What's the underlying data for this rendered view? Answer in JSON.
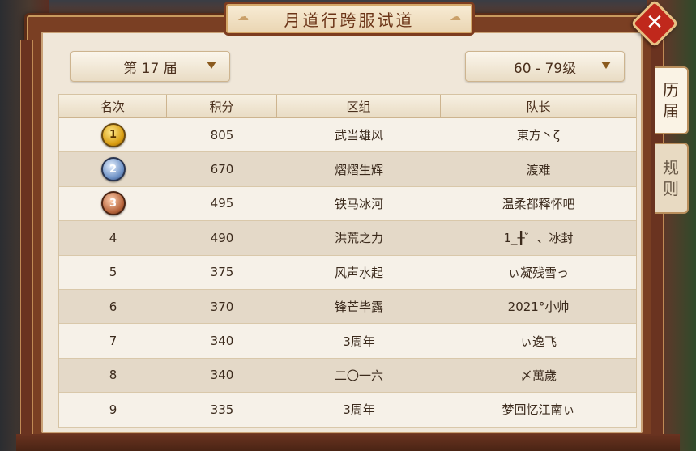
{
  "title": "月道行跨服试道",
  "close_label": "✕",
  "dropdowns": {
    "session": "第 17 届",
    "level": "60 - 79级"
  },
  "tabs": {
    "history": [
      "历",
      "届"
    ],
    "rules": [
      "规",
      "则"
    ]
  },
  "table": {
    "headers": [
      "名次",
      "积分",
      "区组",
      "队长"
    ],
    "rows": [
      {
        "rank": "1",
        "medal": "gold",
        "score": "805",
        "group": "武当雄风",
        "captain": "東方丶ζ"
      },
      {
        "rank": "2",
        "medal": "silver",
        "score": "670",
        "group": "熠熠生辉",
        "captain": "渡难"
      },
      {
        "rank": "3",
        "medal": "bronze",
        "score": "495",
        "group": "铁马冰河",
        "captain": "温柔都释怀吧"
      },
      {
        "rank": "4",
        "medal": "",
        "score": "490",
        "group": "洪荒之力",
        "captain": "1_╂゛、冰封"
      },
      {
        "rank": "5",
        "medal": "",
        "score": "375",
        "group": "风声水起",
        "captain": "ぃ凝残雪っ"
      },
      {
        "rank": "6",
        "medal": "",
        "score": "370",
        "group": "锋芒毕露",
        "captain": "2021°小帅"
      },
      {
        "rank": "7",
        "medal": "",
        "score": "340",
        "group": "3周年",
        "captain": "ぃ逸飞"
      },
      {
        "rank": "8",
        "medal": "",
        "score": "340",
        "group": "二〇一六",
        "captain": "〆萬歲"
      },
      {
        "rank": "9",
        "medal": "",
        "score": "335",
        "group": "3周年",
        "captain": "梦回忆江南ぃ"
      }
    ]
  }
}
